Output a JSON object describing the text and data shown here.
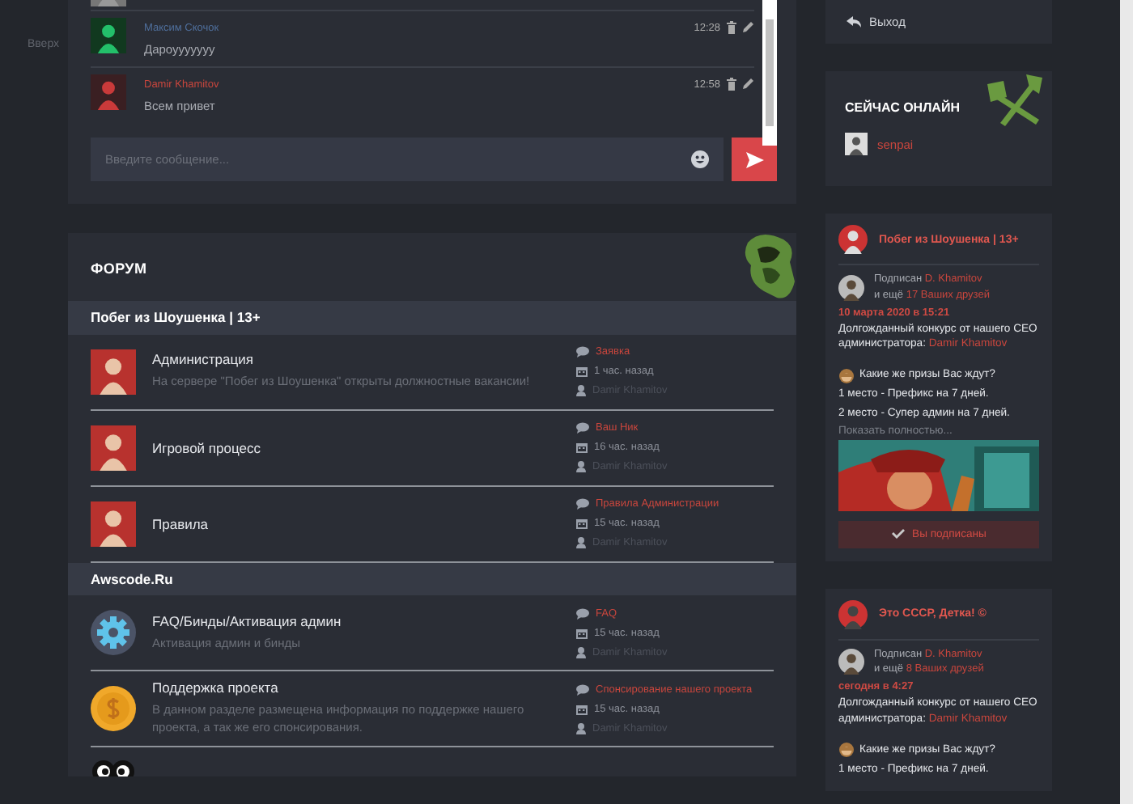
{
  "rail": {
    "top_link": "Вверх"
  },
  "chat": {
    "messages": [
      {
        "kind": "cut"
      },
      {
        "kind": "message",
        "author": "Максим Скочок",
        "color": "#4f6f9c",
        "time": "12:28",
        "text": "Дароууууууу"
      },
      {
        "kind": "message",
        "author": "Damir Khamitov",
        "color": "#c9463d",
        "time": "12:58",
        "text": "Всем привет"
      }
    ],
    "input": {
      "placeholder": "Введите сообщение..."
    }
  },
  "forum": {
    "title": "ФОРУМ",
    "categories": [
      {
        "name": "Побег из Шоушенка | 13+",
        "forums": [
          {
            "title": "Администрация",
            "description": "На сервере \"Побег из Шоушенка\" открыты должностные вакансии!",
            "last_topic": "Заявка",
            "last_time": "1 час. назад",
            "last_author": "Damir Khamitov"
          },
          {
            "title": "Игровой процесс",
            "last_topic": "Ваш Ник",
            "last_time": "16 час. назад",
            "last_author": "Damir Khamitov"
          },
          {
            "title": "Правила",
            "last_topic": "Правила Администрации",
            "last_time": "15 час. назад",
            "last_author": "Damir Khamitov"
          }
        ]
      },
      {
        "name": "Awscode.Ru",
        "forums": [
          {
            "title": "FAQ/Бинды/Активация админ",
            "description": "Активация админ и бинды",
            "last_topic": "FAQ",
            "last_time": "15 час. назад",
            "last_author": "Damir Khamitov"
          },
          {
            "title": "Поддержка проекта",
            "description": "В данном разделе размещена информация по поддержке нашего проекта, а так же его спонсирования.",
            "last_topic": "Спонсирование нашего проекта",
            "last_time": "15 час. назад",
            "last_author": "Damir Khamitov"
          },
          {
            "kind": "cut"
          }
        ]
      }
    ]
  },
  "user_menu": {
    "logout": "Выход"
  },
  "online": {
    "title": "СЕЙЧАС ОНЛАЙН",
    "users": [
      {
        "name": "senpai"
      }
    ]
  },
  "feeds": [
    {
      "group": "Побег из Шоушенка | 13+",
      "subscribed_label": "Подписан",
      "subscribed_by": "D. Khamitov",
      "and_more": "и ещё",
      "friends": "17 Ваших друзей",
      "date": "10 марта 2020 в 15:21",
      "post": [
        {
          "kind": "text",
          "text": "Долгожданный конкурс от нашего CEO администратора:",
          "link": "Damir Khamitov"
        },
        {
          "kind": "emoji",
          "text": "Какие же призы Вас ждут?"
        },
        {
          "kind": "text",
          "text": "1 место - Префикс на 7 дней."
        },
        {
          "kind": "text",
          "text": "2 место - Супер админ на 7 дней."
        },
        {
          "kind": "more",
          "text": "Показать полностью..."
        },
        {
          "kind": "picture"
        }
      ],
      "subscribe": "Вы подписаны"
    },
    {
      "group": "Это СССР, Детка! ©",
      "subscribed_label": "Подписан",
      "subscribed_by": "D. Khamitov",
      "and_more": "и ещё",
      "friends": "8 Ваших друзей",
      "date": "сегодня в 4:27",
      "post": [
        {
          "kind": "text",
          "text": "Долгожданный конкурс от нашего CEO администратора:",
          "link": "Damir Khamitov"
        },
        {
          "kind": "emoji",
          "text": "Какие же призы Вас ждут?"
        },
        {
          "kind": "text",
          "text": "1 место - Префикс на 7 дней."
        }
      ]
    }
  ]
}
